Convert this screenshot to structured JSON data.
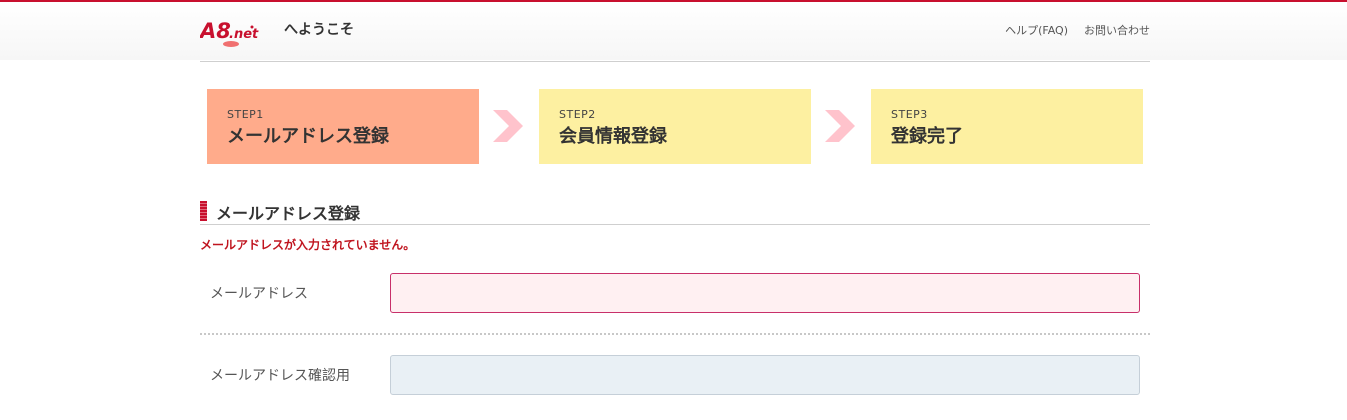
{
  "header": {
    "logo_text": "A8.net",
    "welcome": "へようこそ",
    "links": [
      "ヘルプ(FAQ)",
      "お問い合わせ"
    ]
  },
  "steps": [
    {
      "num": "STEP1",
      "title": "メールアドレス登録",
      "state": "active"
    },
    {
      "num": "STEP2",
      "title": "会員情報登録",
      "state": "pending"
    },
    {
      "num": "STEP3",
      "title": "登録完了",
      "state": "pending"
    }
  ],
  "section": {
    "title": "メールアドレス登録",
    "error": "メールアドレスが入力されていません。"
  },
  "form": {
    "email_label": "メールアドレス",
    "email_value": "",
    "confirm_label": "メールアドレス確認用",
    "confirm_value": ""
  },
  "colors": {
    "accent": "#c8102e",
    "step_active": "#ffab8b",
    "step_pending": "#fdf0a1",
    "arrow": "#ffc3cc",
    "error_text": "#c0151f"
  }
}
